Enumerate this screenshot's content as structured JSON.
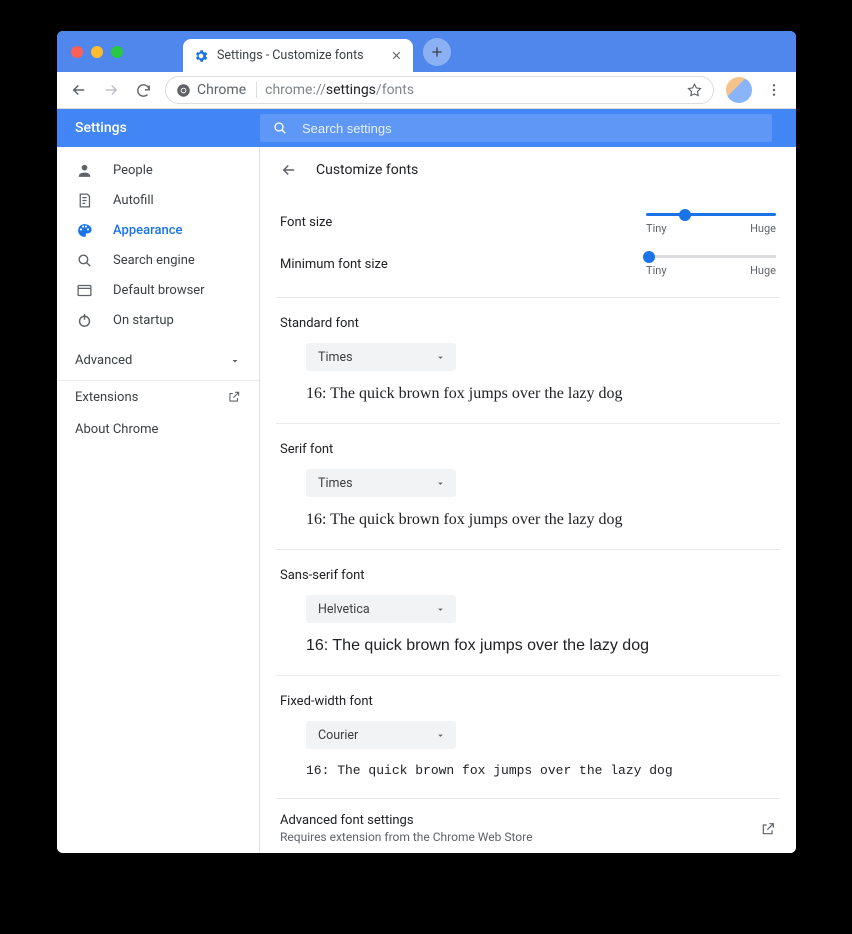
{
  "tab": {
    "title": "Settings - Customize fonts"
  },
  "omnibox": {
    "chip": "Chrome",
    "url_prefix": "chrome://",
    "url_bold": "settings",
    "url_suffix": "/fonts"
  },
  "header": {
    "title": "Settings"
  },
  "search": {
    "placeholder": "Search settings"
  },
  "sidebar": {
    "items": [
      {
        "icon": "person",
        "label": "People"
      },
      {
        "icon": "autofill",
        "label": "Autofill"
      },
      {
        "icon": "palette",
        "label": "Appearance",
        "active": true
      },
      {
        "icon": "search",
        "label": "Search engine"
      },
      {
        "icon": "browser",
        "label": "Default browser"
      },
      {
        "icon": "power",
        "label": "On startup"
      }
    ],
    "advanced": "Advanced",
    "extensions": "Extensions",
    "about": "About Chrome"
  },
  "page": {
    "title": "Customize fonts",
    "font_size": {
      "label": "Font size",
      "min_label": "Tiny",
      "max_label": "Huge",
      "value_pct": 30
    },
    "min_font_size": {
      "label": "Minimum font size",
      "min_label": "Tiny",
      "max_label": "Huge",
      "value_pct": 2
    },
    "fonts": {
      "standard": {
        "title": "Standard font",
        "value": "Times",
        "preview": "16: The quick brown fox jumps over the lazy dog"
      },
      "serif": {
        "title": "Serif font",
        "value": "Times",
        "preview": "16: The quick brown fox jumps over the lazy dog"
      },
      "sans": {
        "title": "Sans-serif font",
        "value": "Helvetica",
        "preview": "16: The quick brown fox jumps over the lazy dog"
      },
      "fixed": {
        "title": "Fixed-width font",
        "value": "Courier",
        "preview": "16: The quick brown fox jumps over the lazy dog"
      }
    },
    "advanced_fonts": {
      "title": "Advanced font settings",
      "subtitle": "Requires extension from the Chrome Web Store"
    }
  }
}
